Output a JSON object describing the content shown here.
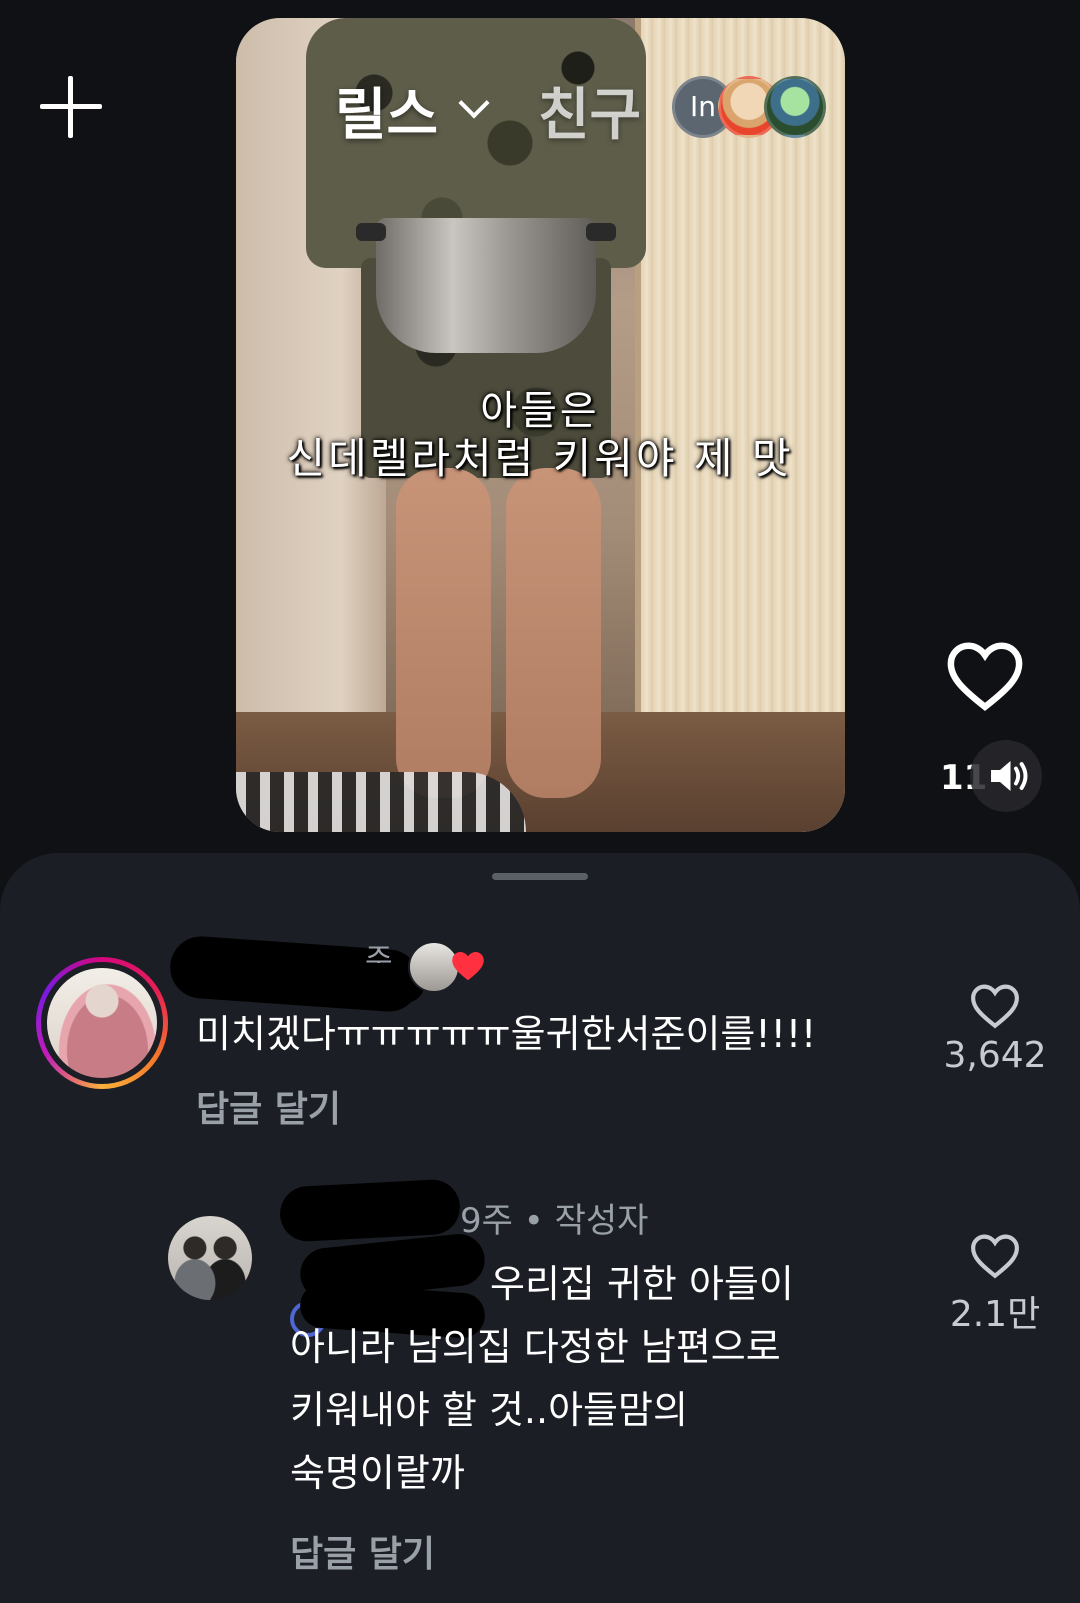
{
  "header": {
    "tab_reels": "릴스",
    "tab_friends": "친구",
    "friend_avatar_initials": "In"
  },
  "video": {
    "caption_line1": "아들은",
    "caption_line2": "신데렐라처럼 키워야 제 맛"
  },
  "actions": {
    "like_count": "11"
  },
  "comments": [
    {
      "meta_partial": "주",
      "text": "미치겠다ㅠㅠㅠㅠㅠ울귀한서준이를!!!!",
      "reply_label": "답글 달기",
      "likes": "3,642"
    },
    {
      "meta": "9주 • 작성자",
      "text_line1": "우리집 귀한 아들이",
      "text_line2": "아니라 남의집 다정한 남편으로",
      "text_line3": "키워내야 할 것..아들맘의",
      "text_line4": "숙명이랄까",
      "reply_label": "답글 달기",
      "likes": "2.1만"
    }
  ],
  "colors": {
    "background": "#0f1115",
    "sheet": "#1b1e24",
    "secondary_text": "#9aa0a8",
    "heart_red": "#ff3040"
  },
  "icons": [
    "plus-icon",
    "chevron-down-icon",
    "heart-icon",
    "sound-icon"
  ]
}
